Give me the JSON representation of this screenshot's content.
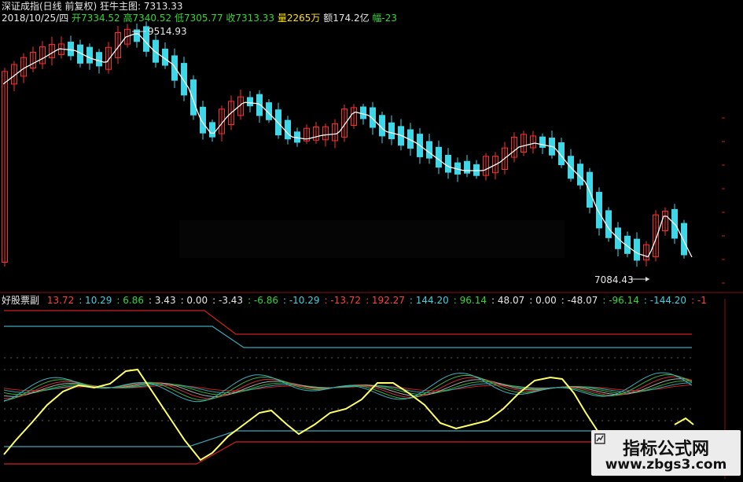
{
  "header": {
    "title": "深证成指(日线 前复权)",
    "indicator_label": "狂牛主图",
    "indicator_value": ": 7313.33",
    "date": "2018/10/25/四",
    "open": "开7334.52",
    "high": "高7340.52",
    "low": "低7305.77",
    "close": "收7313.33",
    "volume": "量2265万",
    "amount": "额174.2亿",
    "change": "幅-23"
  },
  "sub_panel": {
    "name": "好股票副",
    "readouts": [
      {
        "text": "13.72",
        "color": "red"
      },
      {
        "text": ": 10.29",
        "color": "cyan"
      },
      {
        "text": ": 6.86",
        "color": "green"
      },
      {
        "text": ": 3.43",
        "color": "white"
      },
      {
        "text": ": 0.00",
        "color": "white"
      },
      {
        "text": ": -3.43",
        "color": "white"
      },
      {
        "text": ": -6.86",
        "color": "green"
      },
      {
        "text": ": -10.29",
        "color": "cyan"
      },
      {
        "text": ": -13.72",
        "color": "red"
      },
      {
        "text": ": 192.27",
        "color": "red"
      },
      {
        "text": ": 144.20",
        "color": "cyan"
      },
      {
        "text": ": 96.14",
        "color": "green"
      },
      {
        "text": ": 48.07",
        "color": "white"
      },
      {
        "text": ": 0.00",
        "color": "white"
      },
      {
        "text": ": -48.07",
        "color": "white"
      },
      {
        "text": ": -96.14",
        "color": "green"
      },
      {
        "text": ": -144.20",
        "color": "cyan"
      },
      {
        "text": ": -1",
        "color": "red"
      }
    ]
  },
  "annotations": {
    "high_mark": "9514.93",
    "low_mark": "7084.43"
  },
  "watermark": {
    "title": "指标公式网",
    "url": "www.zbgs3.com"
  },
  "colors": {
    "up": "#ff3030",
    "down": "#3fd6e8",
    "ma": "#ffffff",
    "osc": "#ffff66",
    "band_red": "#d02020",
    "band_cyan": "#3aa8b8"
  }
}
